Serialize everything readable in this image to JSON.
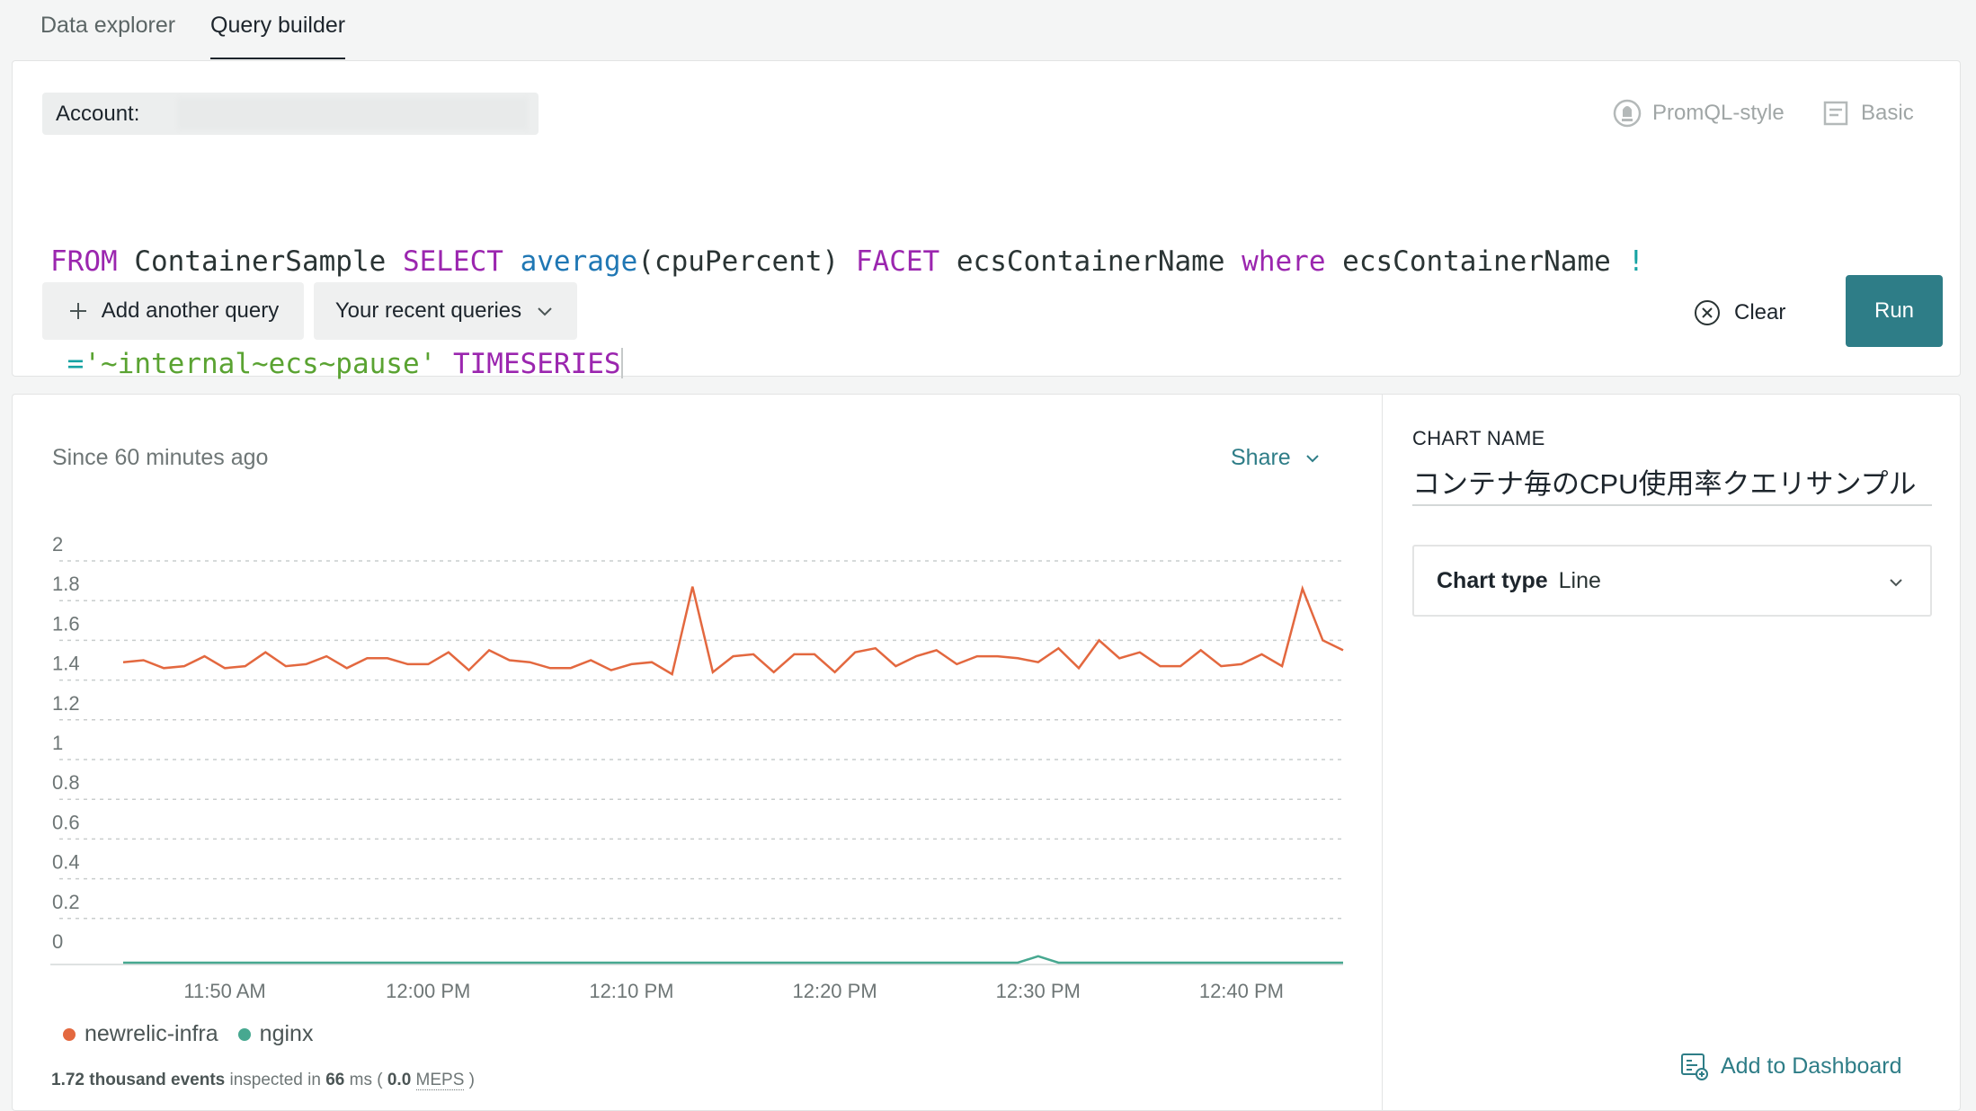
{
  "tabs": [
    {
      "label": "Data explorer",
      "active": false
    },
    {
      "label": "Query builder",
      "active": true
    }
  ],
  "query": {
    "account_label": "Account:",
    "modes": [
      {
        "label": "PromQL-style",
        "icon": "promql-icon"
      },
      {
        "label": "Basic",
        "icon": "basic-icon"
      }
    ],
    "tokens_line1": [
      {
        "t": "FROM",
        "c": "kw"
      },
      {
        "t": " ContainerSample ",
        "c": ""
      },
      {
        "t": "SELECT",
        "c": "kw"
      },
      {
        "t": " ",
        "c": ""
      },
      {
        "t": "average",
        "c": "fn"
      },
      {
        "t": "(cpuPercent) ",
        "c": ""
      },
      {
        "t": "FACET",
        "c": "kw"
      },
      {
        "t": " ecsContainerName ",
        "c": ""
      },
      {
        "t": "where",
        "c": "kw"
      },
      {
        "t": " ecsContainerName ",
        "c": ""
      },
      {
        "t": "!",
        "c": "op"
      }
    ],
    "tokens_line2": [
      {
        "t": " ",
        "c": ""
      },
      {
        "t": "=",
        "c": "op"
      },
      {
        "t": "'~internal~ecs~pause'",
        "c": "str"
      },
      {
        "t": " ",
        "c": ""
      },
      {
        "t": "TIMESERIES",
        "c": "kw"
      }
    ],
    "add_query_label": "Add another query",
    "recent_label": "Your recent queries",
    "clear_label": "Clear",
    "run_label": "Run"
  },
  "chart": {
    "since_label": "Since 60 minutes ago",
    "share_label": "Share",
    "stats": {
      "events": "1.72 thousand events",
      "mid": " inspected in ",
      "ms": "66",
      "ms_unit": " ms ( ",
      "meps_val": "0.0",
      "meps": "MEPS",
      "end": " )"
    }
  },
  "chart_data": {
    "type": "line",
    "x": [
      "11:45",
      "11:46",
      "11:47",
      "11:48",
      "11:49",
      "11:50",
      "11:51",
      "11:52",
      "11:53",
      "11:54",
      "11:55",
      "11:56",
      "11:57",
      "11:58",
      "11:59",
      "12:00",
      "12:01",
      "12:02",
      "12:03",
      "12:04",
      "12:05",
      "12:06",
      "12:07",
      "12:08",
      "12:09",
      "12:10",
      "12:11",
      "12:12",
      "12:13",
      "12:14",
      "12:15",
      "12:16",
      "12:17",
      "12:18",
      "12:19",
      "12:20",
      "12:21",
      "12:22",
      "12:23",
      "12:24",
      "12:25",
      "12:26",
      "12:27",
      "12:28",
      "12:29",
      "12:30",
      "12:31",
      "12:32",
      "12:33",
      "12:34",
      "12:35",
      "12:36",
      "12:37",
      "12:38",
      "12:39",
      "12:40",
      "12:41",
      "12:42",
      "12:43",
      "12:44",
      "12:45"
    ],
    "xticks": [
      "11:50 AM",
      "12:00 PM",
      "12:10 PM",
      "12:20 PM",
      "12:30 PM",
      "12:40 PM"
    ],
    "xtick_idx": [
      5,
      15,
      25,
      35,
      45,
      55
    ],
    "ylim": [
      0,
      2.05
    ],
    "yticks": [
      "2",
      "1.8",
      "1.6",
      "1.4",
      "1.2",
      "1",
      "0.8",
      "0.6",
      "0.4",
      "0.2",
      "0"
    ],
    "ytick_vals": [
      2,
      1.8,
      1.6,
      1.4,
      1.2,
      1,
      0.8,
      0.6,
      0.4,
      0.2,
      0
    ],
    "grid": true,
    "legend_position": "bottom-left",
    "series": [
      {
        "name": "newrelic-infra",
        "color": "#e3683f",
        "values": [
          1.49,
          1.5,
          1.46,
          1.47,
          1.52,
          1.46,
          1.47,
          1.54,
          1.47,
          1.48,
          1.52,
          1.46,
          1.51,
          1.51,
          1.48,
          1.48,
          1.54,
          1.45,
          1.55,
          1.5,
          1.49,
          1.46,
          1.46,
          1.5,
          1.45,
          1.48,
          1.49,
          1.43,
          1.87,
          1.44,
          1.52,
          1.53,
          1.44,
          1.53,
          1.53,
          1.44,
          1.54,
          1.56,
          1.47,
          1.52,
          1.55,
          1.48,
          1.52,
          1.52,
          1.51,
          1.49,
          1.56,
          1.46,
          1.6,
          1.51,
          1.54,
          1.47,
          1.47,
          1.55,
          1.47,
          1.48,
          1.53,
          1.47,
          1.86,
          1.6,
          1.55
        ]
      },
      {
        "name": "nginx",
        "color": "#47a890",
        "values": [
          0,
          0,
          0,
          0,
          0,
          0,
          0,
          0,
          0,
          0,
          0,
          0,
          0,
          0,
          0,
          0,
          0,
          0,
          0,
          0,
          0,
          0,
          0,
          0,
          0,
          0,
          0,
          0,
          0,
          0,
          0,
          0,
          0,
          0,
          0,
          0,
          0,
          0,
          0,
          0,
          0,
          0,
          0,
          0,
          0,
          0.01,
          0,
          0,
          0,
          0,
          0,
          0,
          0,
          0,
          0,
          0,
          0,
          0,
          0,
          0,
          0
        ]
      }
    ]
  },
  "side": {
    "chart_name_label": "CHART NAME",
    "chart_name_value": "コンテナ毎のCPU使用率クエリサンプル",
    "chart_type_label": "Chart type",
    "chart_type_value": "Line",
    "add_dashboard_label": "Add to Dashboard"
  }
}
